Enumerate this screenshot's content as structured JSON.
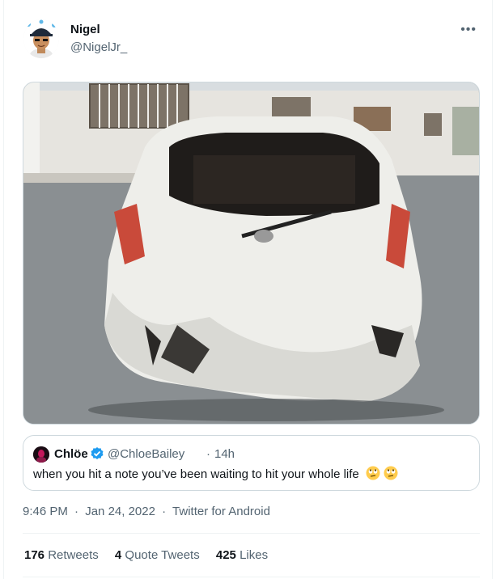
{
  "tweet": {
    "author": {
      "name": "Nigel",
      "handle": "@NigelJr_"
    },
    "more_icon": "more-horizontal-icon",
    "media": {
      "description_icon": "crashed-car-photo"
    },
    "quoted": {
      "name": "Chlöe",
      "handle": "@ChloeBailey",
      "separator": "·",
      "time": "14h",
      "text": "when you hit a note you’ve been waiting to hit your whole life",
      "verified_icon": "verified-badge-icon",
      "emoji_icon": "rolling-eyes-emoji-icon"
    },
    "meta": {
      "time": "9:46 PM",
      "sep1": "·",
      "date": "Jan 24, 2022",
      "sep2": "·",
      "source": "Twitter for Android"
    },
    "stats": {
      "retweets": {
        "count": "176",
        "label": "Retweets"
      },
      "quotes": {
        "count": "4",
        "label": "Quote Tweets"
      },
      "likes": {
        "count": "425",
        "label": "Likes"
      }
    }
  },
  "colors": {
    "text_primary": "#0f1419",
    "text_secondary": "#536471",
    "border": "#cfd9de",
    "verified": "#1d9bf0"
  }
}
